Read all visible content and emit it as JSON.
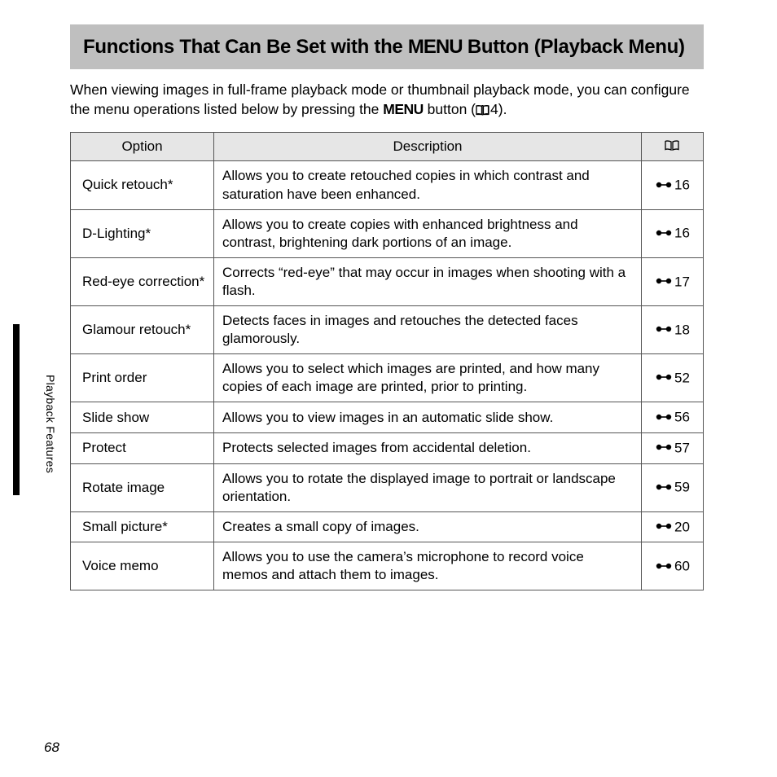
{
  "heading": {
    "pre": "Functions That Can Be Set with the ",
    "menu_glyph": "MENU",
    "post": " Button (Playback Menu)"
  },
  "intro": {
    "line1": "When viewing images in full-frame playback mode or thumbnail playback mode, you can configure the menu operations listed below by pressing the ",
    "menu_glyph": "MENU",
    "mid": " button (",
    "ref": "4",
    "end": ")."
  },
  "table": {
    "headers": {
      "option": "Option",
      "description": "Description"
    },
    "rows": [
      {
        "option": "Quick retouch*",
        "description": "Allows you to create retouched copies in which contrast and saturation have been enhanced.",
        "ref": "16"
      },
      {
        "option": "D-Lighting*",
        "description": "Allows you to create copies with enhanced brightness and contrast, brightening dark portions of an image.",
        "ref": "16"
      },
      {
        "option": "Red-eye correction*",
        "description": "Corrects “red-eye” that may occur in images when shooting with a flash.",
        "ref": "17"
      },
      {
        "option": "Glamour retouch*",
        "description": "Detects faces in images and retouches the detected faces glamorously.",
        "ref": "18"
      },
      {
        "option": "Print order",
        "description": "Allows you to select which images are printed, and how many copies of each image are printed, prior to printing.",
        "ref": "52"
      },
      {
        "option": "Slide show",
        "description": "Allows you to view images in an automatic slide show.",
        "ref": "56"
      },
      {
        "option": "Protect",
        "description": "Protects selected images from accidental deletion.",
        "ref": "57"
      },
      {
        "option": "Rotate image",
        "description": "Allows you to rotate the displayed image to portrait or landscape orientation.",
        "ref": "59"
      },
      {
        "option": "Small picture*",
        "description": "Creates a small copy of images.",
        "ref": "20"
      },
      {
        "option": "Voice memo",
        "description": "Allows you to use the camera’s microphone to record voice memos and attach them to images.",
        "ref": "60"
      }
    ]
  },
  "side_label": "Playback Features",
  "page_number": "68"
}
